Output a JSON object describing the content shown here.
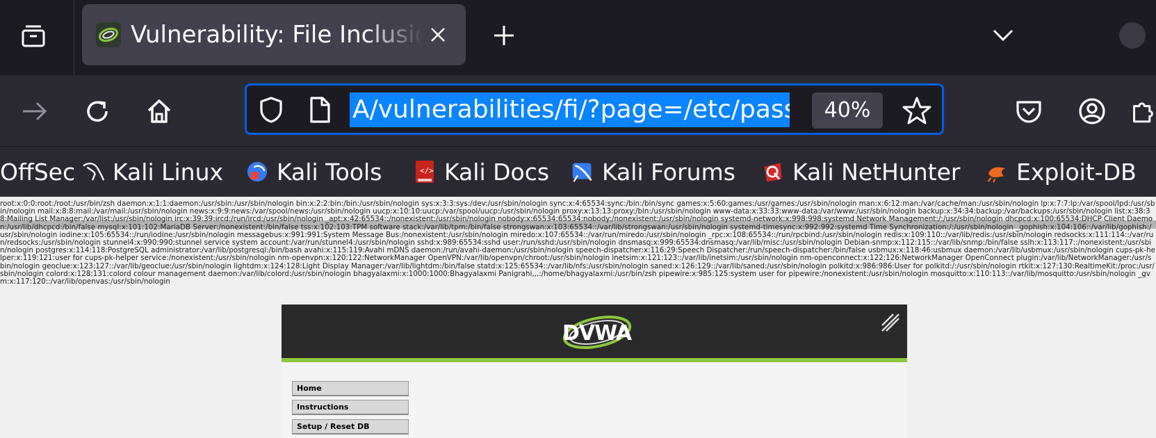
{
  "browser": {
    "tab": {
      "title": "Vulnerability: File Inclusion"
    },
    "url": {
      "value": "A/vulnerabilities/fi/?page=/etc/passwd",
      "zoom": "40%"
    },
    "bookmarks": [
      {
        "label": "OffSec",
        "icon": "offsec-icon"
      },
      {
        "label": "Kali Linux",
        "icon": "kali-dragon-icon"
      },
      {
        "label": "Kali Tools",
        "icon": "kali-tools-icon"
      },
      {
        "label": "Kali Docs",
        "icon": "kali-docs-icon"
      },
      {
        "label": "Kali Forums",
        "icon": "kali-forums-icon"
      },
      {
        "label": "Kali NetHunter",
        "icon": "nethunter-icon"
      },
      {
        "label": "Exploit-DB",
        "icon": "exploitdb-icon"
      }
    ],
    "colors": {
      "accent": "#0060df",
      "selection": "#0a84ff"
    }
  },
  "page": {
    "passwd_text": "root:x:0:0:root:/root:/usr/bin/zsh daemon:x:1:1:daemon:/usr/sbin:/usr/sbin/nologin bin:x:2:2:bin:/bin:/usr/sbin/nologin sys:x:3:3:sys:/dev:/usr/sbin/nologin sync:x:4:65534:sync:/bin:/bin/sync games:x:5:60:games:/usr/games:/usr/sbin/nologin man:x:6:12:man:/var/cache/man:/usr/sbin/nologin lp:x:7:7:lp:/var/spool/lpd:/usr/sbin/nologin mail:x:8:8:mail:/var/mail:/usr/sbin/nologin news:x:9:9:news:/var/spool/news:/usr/sbin/nologin uucp:x:10:10:uucp:/var/spool/uucp:/usr/sbin/nologin proxy:x:13:13:proxy:/bin:/usr/sbin/nologin www-data:x:33:33:www-data:/var/www:/usr/sbin/nologin backup:x:34:34:backup:/var/backups:/usr/sbin/nologin list:x:38:38:Mailing List Manager:/var/list:/usr/sbin/nologin irc:x:39:39:ircd:/run/ircd:/usr/sbin/nologin _apt:x:42:65534::/nonexistent:/usr/sbin/nologin nobody:x:65534:65534:nobody:/nonexistent:/usr/sbin/nologin systemd-network:x:998:998:systemd Network Management:/:/usr/sbin/nologin dhcpcd:x:100:65534:DHCP Client Daemon:/usr/lib/dhcpcd:/bin/false mysql:x:101:102:MariaDB Server:/nonexistent:/bin/false tss:x:102:103:TPM software stack:/var/lib/tpm:/bin/false strongswan:x:103:65534::/var/lib/strongswan:/usr/sbin/nologin systemd-timesync:x:992:992:systemd Time Synchronization:/:/usr/sbin/nologin _gophish:x:104:106::/var/lib/gophish:/usr/sbin/nologin iodine:x:105:65534::/run/iodine:/usr/sbin/nologin messagebus:x:991:991:System Message Bus:/nonexistent:/usr/sbin/nologin miredo:x:107:65534::/var/run/miredo:/usr/sbin/nologin _rpc:x:108:65534::/run/rpcbind:/usr/sbin/nologin redis:x:109:110::/var/lib/redis:/usr/sbin/nologin redsocks:x:111:114::/var/run/redsocks:/usr/sbin/nologin stunnel4:x:990:990:stunnel service system account:/var/run/stunnel4:/usr/sbin/nologin sshd:x:989:65534:sshd user:/run/sshd:/usr/sbin/nologin dnsmasq:x:999:65534:dnsmasq:/var/lib/misc:/usr/sbin/nologin Debian-snmp:x:112:115::/var/lib/snmp:/bin/false sslh:x:113:117::/nonexistent:/usr/sbin/nologin postgres:x:114:118:PostgreSQL administrator:/var/lib/postgresql:/bin/bash avahi:x:115:119:Avahi mDNS daemon:/run/avahi-daemon:/usr/sbin/nologin speech-dispatcher:x:116:29:Speech Dispatcher:/run/speech-dispatcher:/bin/false usbmux:x:118:46:usbmux daemon:/var/lib/usbmux:/usr/sbin/nologin cups-pk-helper:x:119:121:user for cups-pk-helper service:/nonexistent:/usr/sbin/nologin nm-openvpn:x:120:122:NetworkManager OpenVPN:/var/lib/openvpn/chroot:/usr/sbin/nologin inetsim:x:121:123::/var/lib/inetsim:/usr/sbin/nologin nm-openconnect:x:122:126:NetworkManager OpenConnect plugin:/var/lib/NetworkManager:/usr/sbin/nologin geoclue:x:123:127::/var/lib/geoclue:/usr/sbin/nologin lightdm:x:124:128:Light Display Manager:/var/lib/lightdm:/bin/false statd:x:125:65534::/var/lib/nfs:/usr/sbin/nologin saned:x:126:129::/var/lib/saned:/usr/sbin/nologin polkitd:x:986:986:User for polkitd:/:/usr/sbin/nologin rtkit:x:127:130:RealtimeKit:/proc:/usr/sbin/nologin colord:x:128:131:colord colour management daemon:/var/lib/colord:/usr/sbin/nologin bhagyalaxmi:x:1000:1000:Bhagyalaxmi Panigrahi,,,:/home/bhagyalaxmi:/usr/bin/zsh pipewire:x:985:125:system user for pipewire:/nonexistent:/usr/sbin/nologin mosquitto:x:110:113::/var/lib/mosquitto:/usr/sbin/nologin _gvm:x:117:120::/var/lib/openvas:/usr/sbin/nologin",
    "dvwa": {
      "logo": "DVWA",
      "menu": [
        "Home",
        "Instructions",
        "Setup / Reset DB"
      ]
    }
  }
}
